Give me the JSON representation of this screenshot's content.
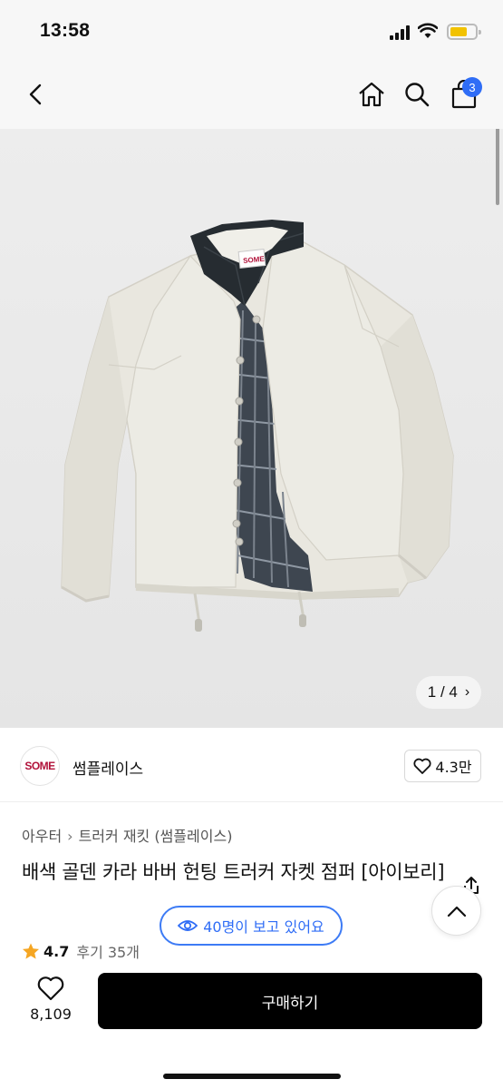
{
  "status": {
    "time": "13:58"
  },
  "nav": {
    "back_icon": "chevron-left-icon",
    "home_icon": "home-icon",
    "search_icon": "search-icon",
    "cart_icon": "shopping-bag-icon",
    "cart_badge": "3"
  },
  "gallery": {
    "counter": "1 / 4",
    "counter_chevron": "›"
  },
  "shop": {
    "logo_text": "SOME",
    "name": "썸플레이스",
    "likes": "4.3만"
  },
  "product": {
    "breadcrumb": [
      "아우터",
      "트러커 재킷 (썸플레이스)"
    ],
    "breadcrumb_sep": "›",
    "title": "배색 골덴 카라 바버 헌팅 트러커 자켓 점퍼 [아이보리]",
    "rating": "4.7",
    "reviews": "후기 35개"
  },
  "viewers": {
    "text": "40명이 보고 있어요"
  },
  "bottom": {
    "wish_count": "8,109",
    "buy_label": "구매하기"
  },
  "colors": {
    "accent": "#2f6df6",
    "badge": "#2f6df6",
    "buy_bg": "#000000",
    "star": "#f5a623"
  }
}
